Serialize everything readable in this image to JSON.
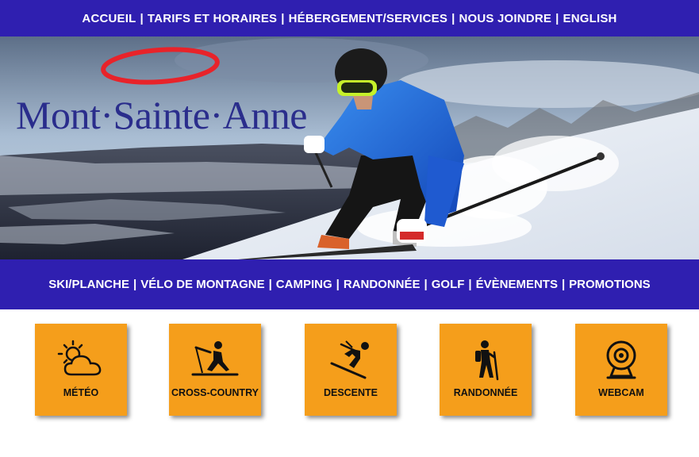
{
  "top_nav": {
    "items": [
      "ACCUEIL",
      "TARIFS ET HORAIRES",
      "HÉBERGEMENT/SERVICES",
      "NOUS JOINDRE",
      "ENGLISH"
    ],
    "separator": "|"
  },
  "hero": {
    "logo_text": "Mont·Sainte·Anne"
  },
  "secondary_nav": {
    "items": [
      "SKI/PLANCHE",
      "VÉLO DE MONTAGNE",
      "CAMPING",
      "RANDONNÉE",
      "GOLF",
      "ÉVÈNEMENTS",
      "PROMOTIONS"
    ],
    "separator": "|"
  },
  "tiles": [
    {
      "label": "MÉTÉO",
      "icon": "weather-sun-cloud-icon"
    },
    {
      "label": "CROSS-COUNTRY",
      "icon": "cross-country-skier-icon"
    },
    {
      "label": "DESCENTE",
      "icon": "downhill-skier-icon"
    },
    {
      "label": "RANDONNÉE",
      "icon": "hiker-icon"
    },
    {
      "label": "WEBCAM",
      "icon": "webcam-icon"
    }
  ],
  "colors": {
    "nav_bar": "#2f1fb0",
    "tile": "#f59e1b",
    "logo_blue": "#2a2d8c",
    "logo_red": "#e8232a"
  }
}
